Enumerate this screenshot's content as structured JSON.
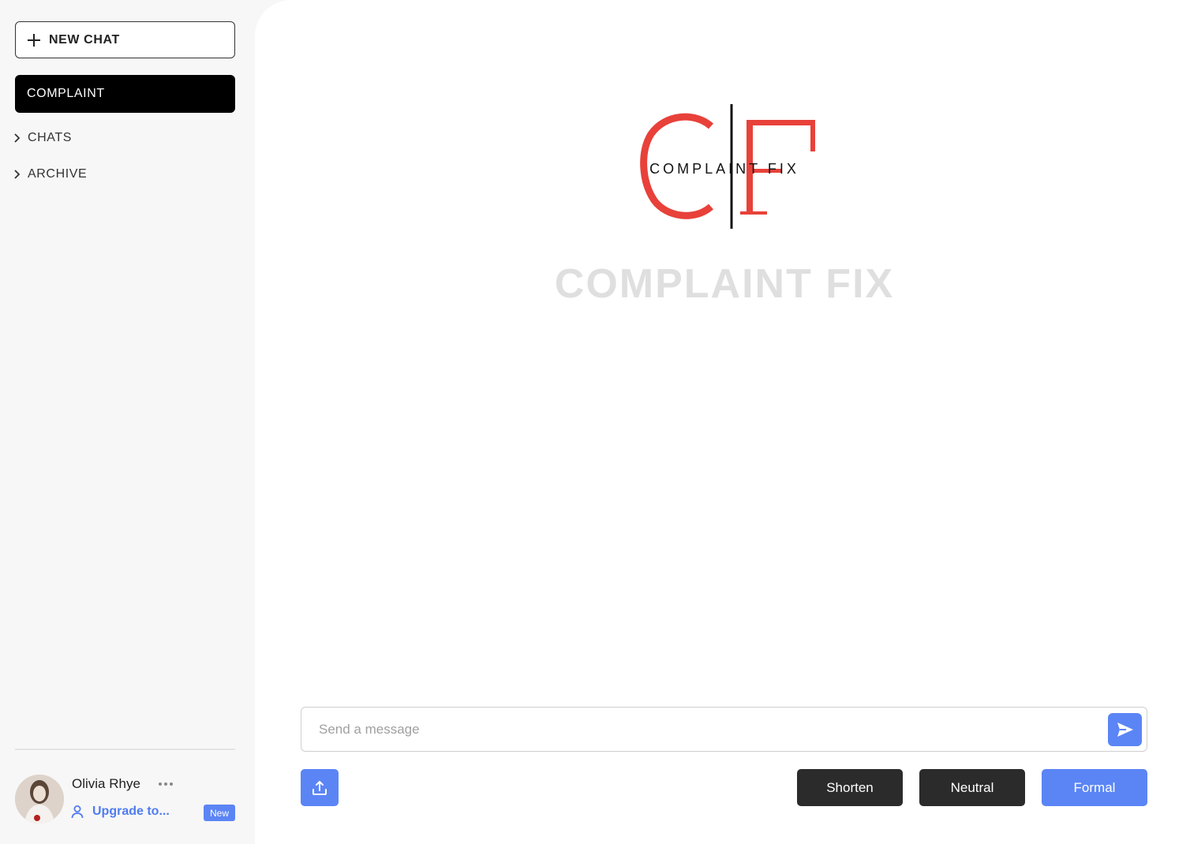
{
  "sidebar": {
    "new_chat_label": "NEW CHAT",
    "active_item_label": "COMPLAINT",
    "items": [
      {
        "label": "CHATS"
      },
      {
        "label": "ARCHIVE"
      }
    ],
    "profile": {
      "name": "Olivia Rhye",
      "upgrade_label": "Upgrade to...",
      "badge": "New"
    }
  },
  "main": {
    "logo_text": "COMPLAINT FIX",
    "title": "COMPLAINT FIX",
    "message_placeholder": "Send a message",
    "tone_buttons": [
      {
        "label": "Shorten"
      },
      {
        "label": "Neutral"
      },
      {
        "label": "Formal"
      }
    ]
  },
  "colors": {
    "accent": "#5b85f5",
    "logo_red": "#e8413a",
    "dark_button": "#2b2b2b"
  }
}
